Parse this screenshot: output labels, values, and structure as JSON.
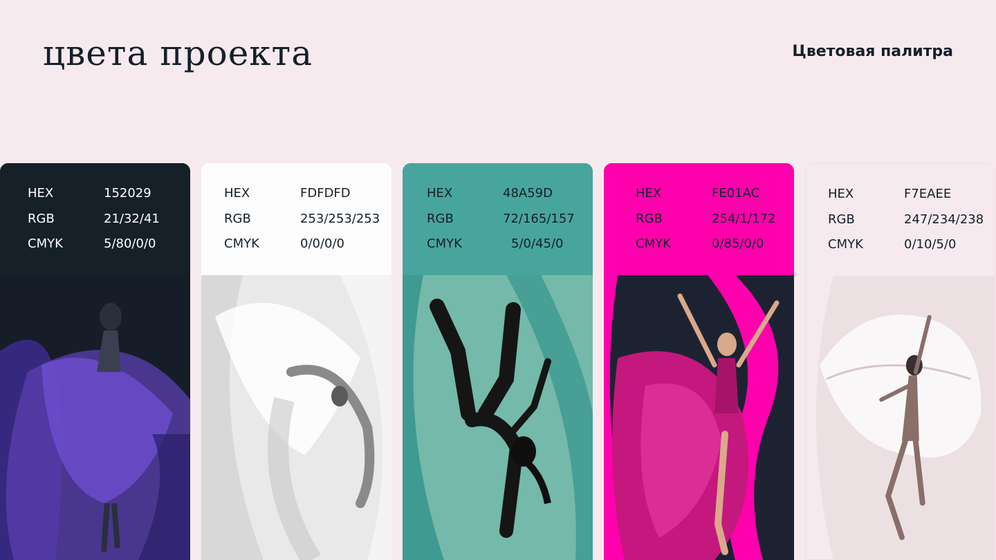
{
  "header": {
    "title": "цвета проекта",
    "subtitle": "Цветовая палитра"
  },
  "labels": {
    "hex": "HEX",
    "rgb": "RGB",
    "cmyk": "CMYK"
  },
  "swatches": [
    {
      "hex": "152029",
      "rgb": "21/32/41",
      "cmyk": "5/80/0/0",
      "color": "#152029",
      "text_color": "#FFFFFF",
      "photo_icon": "dancer-purple-dress-photo",
      "photo_tones": [
        "#1a2230",
        "#5a3fa8"
      ]
    },
    {
      "hex": "FDFDFD",
      "rgb": "253/253/253",
      "cmyk": "0/0/0/0",
      "color": "#FDFDFD",
      "text_color": "#152029",
      "photo_icon": "dancer-white-veil-photo",
      "photo_tones": [
        "#e6e6e6",
        "#9a9a9a"
      ]
    },
    {
      "hex": "48A59D",
      "rgb": "72/165/157",
      "cmyk": "5/0/45/0",
      "color": "#48A59D",
      "text_color": "#152029",
      "photo_icon": "breakdancer-photo",
      "photo_tones": [
        "#6fb8a8",
        "#1a1a1a"
      ]
    },
    {
      "hex": "FE01AC",
      "rgb": "254/1/172",
      "cmyk": "0/85/0/0",
      "color": "#FE01AC",
      "text_color": "#152029",
      "photo_icon": "dancer-pink-dress-photo",
      "photo_tones": [
        "#1d2233",
        "#c4187e"
      ]
    },
    {
      "hex": "F7EAEE",
      "rgb": "247/234/238",
      "cmyk": "0/10/5/0",
      "color": "#F7EAEE",
      "text_color": "#152029",
      "photo_icon": "dancer-sheer-fabric-photo",
      "photo_tones": [
        "#efe3e6",
        "#8a6e6a"
      ]
    }
  ]
}
